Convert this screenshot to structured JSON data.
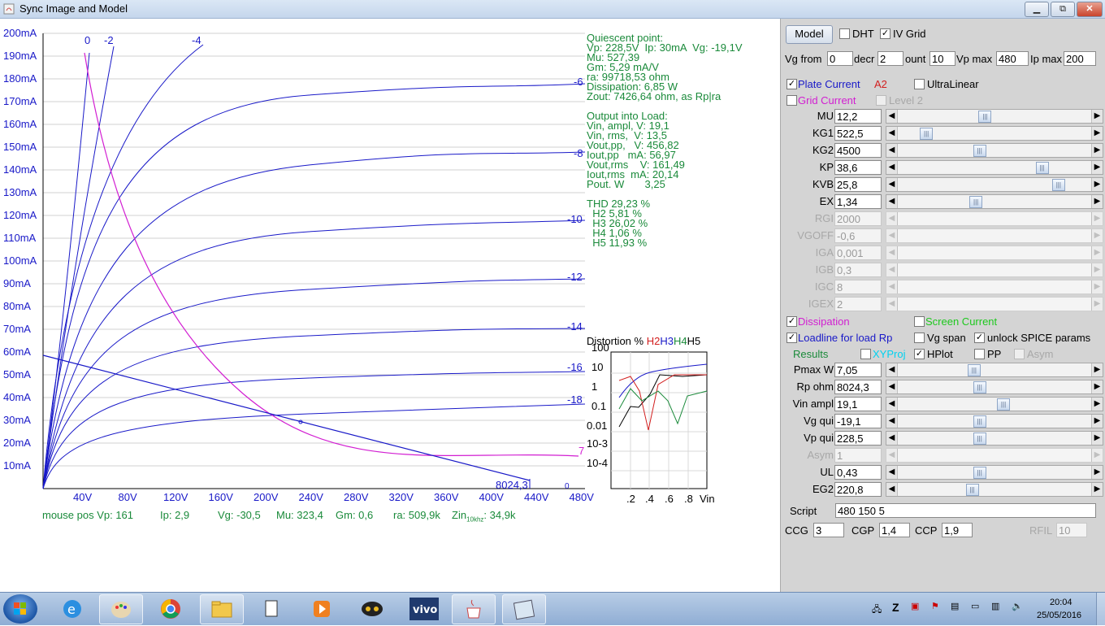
{
  "window": {
    "title": "Sync Image and Model",
    "min_label": "▭",
    "max_label": "⧉",
    "close_label": "✕"
  },
  "plot": {
    "y_labels": [
      "200mA",
      "190mA",
      "180mA",
      "170mA",
      "160mA",
      "150mA",
      "140mA",
      "130mA",
      "120mA",
      "110mA",
      "100mA",
      "90mA",
      "80mA",
      "70mA",
      "60mA",
      "50mA",
      "40mA",
      "30mA",
      "20mA",
      "10mA"
    ],
    "x_labels": [
      "40V",
      "80V",
      "120V",
      "160V",
      "200V",
      "240V",
      "280V",
      "320V",
      "360V",
      "400V",
      "440V",
      "480V"
    ],
    "vg_top_labels": [
      "0",
      "-2",
      "-4"
    ],
    "vg_right_labels": [
      "-6",
      "-8",
      "-10",
      "-12",
      "-14",
      "-16",
      "-18"
    ],
    "load_label": "8024,3",
    "small_labels": [
      "7",
      "0"
    ]
  },
  "info": {
    "quiescent": [
      "Quiescent point:",
      "Vp: 228,5V  Ip: 30mA  Vg: -19,1V",
      "Mu: 527,39",
      "Gm: 5,29 mA/V",
      "ra: 99718,53 ohm",
      "Dissipation: 6,85 W",
      "Zout: 7426,64 ohm, as Rp|ra"
    ],
    "output": [
      "Output into Load:",
      "Vin, ampl, V: 19,1",
      "Vin, rms,  V: 13,5",
      "Vout,pp,   V: 456,82",
      "Iout,pp   mA: 56,97",
      "Vout,rms    V: 161,49",
      "Iout,rms  mA: 20,14",
      "Pout. W       3,25"
    ],
    "thd": [
      "THD 29,23 %",
      "  H2 5,81 %",
      "  H3 26,02 %",
      "  H4 1,06 %",
      "  H5 11,93 %"
    ]
  },
  "mouse_pos": {
    "prefix": "mouse pos Vp: 161",
    "ip": "Ip: 2,9",
    "vg": "Vg: -30,5",
    "mu": "Mu: 323,4",
    "gm": "Gm: 0,6",
    "ra": "ra: 509,9k",
    "zin": "Zin",
    "zin_sub": "10khz",
    "zin_val": ": 34,9k"
  },
  "distortion": {
    "title": "Distortion %",
    "h2": "H2",
    "h3": "H3",
    "h4": "H4",
    "h5": "H5",
    "y_labels": [
      "100",
      "10",
      "1",
      "0.1",
      "0.01",
      "10-3",
      "10-4"
    ],
    "x_labels": [
      ".2",
      ".4",
      ".6",
      ".8",
      "Vin"
    ]
  },
  "panel": {
    "model_button": "Model",
    "dht": "DHT",
    "iv_grid": "IV Grid",
    "vg_from_label": "Vg from",
    "vg_from": "0",
    "decr_label": "decr",
    "decr": "2",
    "count_label": "ount",
    "count": "10",
    "vpmax_label": "Vp max",
    "vpmax": "480",
    "ipmax_label": "Ip max",
    "ipmax": "200",
    "plate_current": "Plate Current",
    "a2": "A2",
    "ultralinear": "UltraLinear",
    "grid_current": "Grid Current",
    "level2": "Level 2",
    "params": [
      {
        "label": "MU",
        "value": "12,2",
        "pos": 0.44,
        "enabled": true
      },
      {
        "label": "KG1",
        "value": "522,5",
        "pos": 0.12,
        "enabled": true
      },
      {
        "label": "KG2",
        "value": "4500",
        "pos": 0.41,
        "enabled": true
      },
      {
        "label": "KP",
        "value": "38,6",
        "pos": 0.75,
        "enabled": true
      },
      {
        "label": "KVB",
        "value": "25,8",
        "pos": 0.84,
        "enabled": true
      },
      {
        "label": "EX",
        "value": "1,34",
        "pos": 0.39,
        "enabled": true
      },
      {
        "label": "RGI",
        "value": "2000",
        "pos": null,
        "enabled": false
      },
      {
        "label": "VGOFF",
        "value": "-0,6",
        "pos": null,
        "enabled": false
      },
      {
        "label": "IGA",
        "value": "0,001",
        "pos": null,
        "enabled": false
      },
      {
        "label": "IGB",
        "value": "0,3",
        "pos": null,
        "enabled": false
      },
      {
        "label": "IGC",
        "value": "8",
        "pos": null,
        "enabled": false
      },
      {
        "label": "IGEX",
        "value": "2",
        "pos": null,
        "enabled": false
      }
    ],
    "dissipation": "Dissipation",
    "screen_current": "Screen Current",
    "loadline": "Loadline for load Rp",
    "vg_span": "Vg span",
    "unlock_spice": "unlock SPICE params",
    "results": "Results",
    "xyproj": "XYProj",
    "hplot": "HPlot",
    "pp": "PP",
    "asym_cb": "Asym",
    "results_params": [
      {
        "label": "Pmax W",
        "value": "7,05",
        "pos": 0.38,
        "enabled": true
      },
      {
        "label": "Rp ohm",
        "value": "8024,3",
        "pos": 0.41,
        "enabled": true
      },
      {
        "label": "Vin ampl",
        "value": "19,1",
        "pos": 0.54,
        "enabled": true
      },
      {
        "label": "Vg qui",
        "value": "-19,1",
        "pos": 0.41,
        "enabled": true
      },
      {
        "label": "Vp qui",
        "value": "228,5",
        "pos": 0.41,
        "enabled": true
      },
      {
        "label": "Asym",
        "value": "1",
        "pos": null,
        "enabled": false
      },
      {
        "label": "UL",
        "value": "0,43",
        "pos": 0.41,
        "enabled": true
      },
      {
        "label": "EG2",
        "value": "220,8",
        "pos": 0.37,
        "enabled": true
      }
    ],
    "script_label": "Script",
    "script": "480 150 5",
    "ccg_label": "CCG",
    "ccg": "3",
    "cgp_label": "CGP",
    "cgp": "1,4",
    "ccp_label": "CCP",
    "ccp": "1,9",
    "rfil_label": "RFIL",
    "rfil": "10"
  },
  "tray": {
    "time": "20:04",
    "date": "25/05/2016"
  },
  "colors": {
    "curve_blue": "#1919c8",
    "dissipation_magenta": "#d21ed2",
    "text_green": "#1a8a3a",
    "h2_red": "#d21e1e",
    "h3_blue": "#1919c8",
    "h4_green": "#1a8a3a"
  }
}
